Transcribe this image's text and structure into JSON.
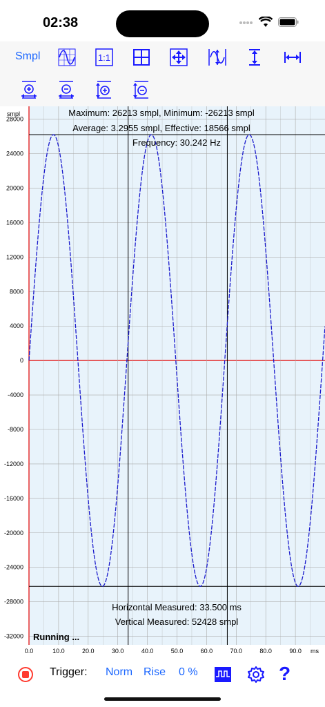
{
  "status_bar": {
    "time": "02:38"
  },
  "toolbar": {
    "smpl_label": "Smpl",
    "icons": [
      "waveform-grid-icon",
      "one-to-one-icon",
      "grid-icon",
      "move-arrows-icon",
      "autoscale-wave-icon",
      "vertical-resize-icon",
      "horizontal-resize-icon",
      "zoom-in-vertical-icon",
      "zoom-out-vertical-icon",
      "zoom-in-horizontal-icon",
      "zoom-out-horizontal-icon"
    ],
    "icon_labels": {
      "one_to_one": "1:1"
    }
  },
  "info": {
    "line1": "Maximum: 26213 smpl, Minimum: -26213 smpl",
    "line2": "Average: 3.2955 smpl, Effective: 18566 smpl",
    "line3": "Frequency: 30.242 Hz",
    "measured_h": "Horizontal Measured: 33.500 ms",
    "measured_v": "Vertical Measured: 52428 smpl",
    "running": "Running ..."
  },
  "chart_data": {
    "type": "line",
    "y_unit_label": "smpl",
    "x_unit_label": "ms",
    "y_ticks": [
      28000,
      24000,
      20000,
      16000,
      12000,
      8000,
      4000,
      0,
      -4000,
      -8000,
      -12000,
      -16000,
      -20000,
      -24000,
      -28000,
      -32000
    ],
    "y_tick_labels": [
      "28000",
      "24000",
      "20000",
      "16000",
      "12000",
      "8000",
      "4000",
      "0",
      "-4000",
      "-8000",
      "-12000",
      "-16000",
      "-20000",
      "-24000",
      "-28000",
      "-32000"
    ],
    "x_tick_labels": [
      "0.0",
      "10.0",
      "20.0",
      "30.0",
      "40.0",
      "50.0",
      "60.0",
      "70.0",
      "80.0",
      "90.0"
    ],
    "x_ticks": [
      0,
      10,
      20,
      30,
      40,
      50,
      60,
      70,
      80,
      90
    ],
    "xlim": [
      0,
      100
    ],
    "ylim": [
      -33000,
      29500
    ],
    "series": [
      {
        "amplitude": 26213,
        "frequency_hz": 30.242,
        "color": "#1a1acc"
      }
    ],
    "cursors": {
      "x_ms": [
        33.5,
        67.0
      ],
      "y_smpl": [
        26213,
        -26213
      ]
    }
  },
  "bottom_bar": {
    "trigger_label": "Trigger:",
    "mode": "Norm",
    "edge": "Rise",
    "level": "0 %"
  },
  "colors": {
    "accent": "#1a66ff",
    "stop": "#ff3b30",
    "axis_zero": "#e53030",
    "plot_bg": "#e8f3fb",
    "grid": "#aaaaaa"
  }
}
